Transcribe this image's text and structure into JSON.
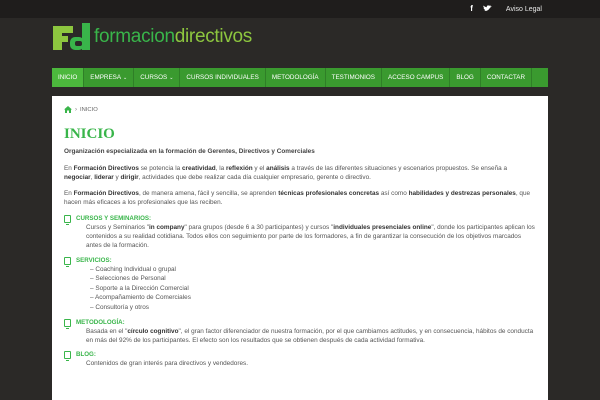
{
  "topbar": {
    "facebook_icon": "f",
    "twitter_icon": "bird-icon",
    "aviso_label": "Aviso Legal"
  },
  "logo": {
    "mark_text": "Fd",
    "text_a": "formacion",
    "text_b": "directivos"
  },
  "colors": {
    "accent": "#39b54a",
    "nav_bg": "#3a9a2f",
    "page_bg": "#2b2927"
  },
  "nav": {
    "items": [
      {
        "label": "INICIO",
        "active": true
      },
      {
        "label": "EMPRESA",
        "caret": "⌄"
      },
      {
        "label": "CURSOS",
        "caret": "⌄"
      },
      {
        "label": "CURSOS INDIVIDUALES"
      },
      {
        "label": "METODOLOGÍA"
      },
      {
        "label": "TESTIMONIOS"
      },
      {
        "label": "ACCESO CAMPUS"
      },
      {
        "label": "BLOG"
      },
      {
        "label": "CONTACTAR"
      }
    ]
  },
  "breadcrumb": {
    "sep": "›",
    "current": "INICIO"
  },
  "page": {
    "title": "INICIO",
    "intro": "Organización especializada en la formación de Gerentes, Directivos y Comerciales",
    "p1": {
      "a": "En ",
      "b": "Formación Directivos",
      "c": " se potencia la ",
      "d": "creatividad",
      "e": ", la ",
      "f": "reflexión",
      "g": " y el ",
      "h": "análisis",
      "i": " a través de las diferentes situaciones y escenarios propuestos. Se enseña a ",
      "j": "negociar",
      "k": ", ",
      "l": "liderar",
      "m": " y ",
      "n": "dirigir",
      "o": ", actividades que debe realizar cada día cualquier empresario, gerente o directivo."
    },
    "p2": {
      "a": "En ",
      "b": "Formación Directivos",
      "c": ", de manera amena, fácil y sencilla, se aprenden ",
      "d": "técnicas profesionales concretas",
      "e": " así como ",
      "f": "habilidades y destrezas personales",
      "g": ", que hacen más eficaces a los profesionales que las reciben."
    }
  },
  "sections": {
    "cursos": {
      "title": "CURSOS Y SEMINARIOS:",
      "a": "Cursos y Seminarios \"",
      "b": "in company",
      "c": "\" para grupos (desde 6 a 30 participantes) y cursos \"",
      "d": "individuales presenciales online",
      "e": "\", donde los participantes aplican los contenidos a su realidad cotidiana. Todos ellos con seguimiento por parte de los formadores, a fin de garantizar la consecución de los objetivos marcados antes de la formación."
    },
    "servicios": {
      "title": "SERVICIOS:",
      "items": [
        "– Coaching Individual o grupal",
        "– Selecciones de Personal",
        "– Soporte a la Dirección Comercial",
        "– Acompañamiento de Comerciales",
        "– Consultoría y otros"
      ]
    },
    "metodologia": {
      "title": "METODOLOGÍA:",
      "a": "Basada en el \"",
      "b": "círculo cognitivo",
      "c": "\", el gran factor diferenciador de nuestra formación, por el que cambiamos actitudes, y en consecuencia, hábitos de conducta en más del 92% de los participantes. El efecto son los resultados que se obtienen después de cada actividad formativa."
    },
    "blog": {
      "title": "BLOG:",
      "text": "Contenidos de gran interés para directivos y vendedores."
    }
  }
}
